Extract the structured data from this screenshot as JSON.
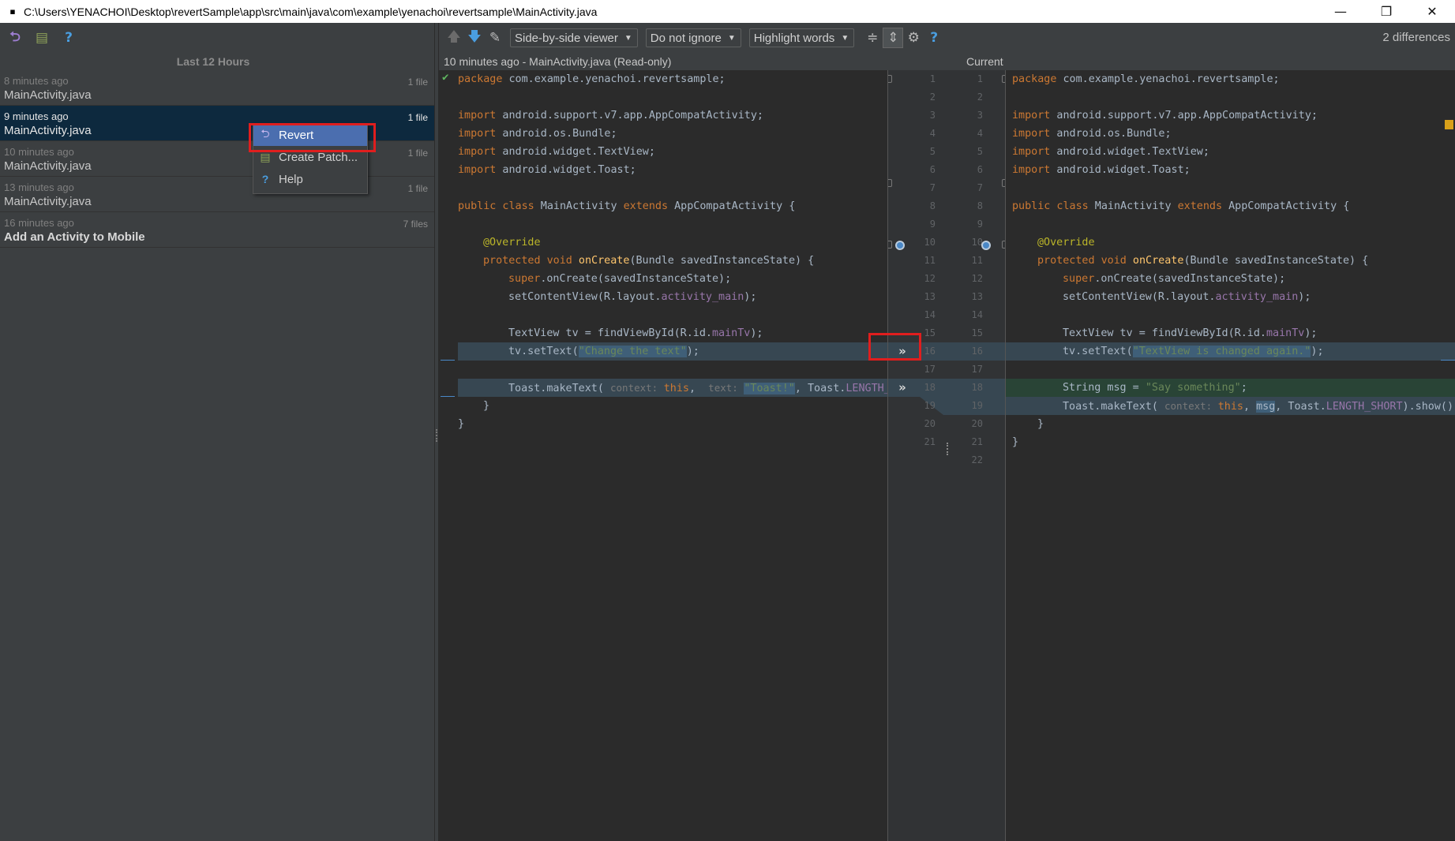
{
  "window": {
    "title": "C:\\Users\\YENACHOI\\Desktop\\revertSample\\app\\src\\main\\java\\com\\example\\yenachoi\\revertsample\\MainActivity.java",
    "minimize": "—",
    "restore": "❐",
    "close": "✕"
  },
  "history": {
    "group_label": "Last 12 Hours",
    "items": [
      {
        "time": "8 minutes ago",
        "name": "MainActivity.java",
        "count": "1 file"
      },
      {
        "time": "9 minutes ago",
        "name": "MainActivity.java",
        "count": "1 file"
      },
      {
        "time": "10 minutes ago",
        "name": "MainActivity.java",
        "count": "1 file"
      },
      {
        "time": "13 minutes ago",
        "name": "MainActivity.java",
        "count": "1 file"
      },
      {
        "time": "16 minutes ago",
        "name": "Add an Activity to Mobile",
        "count": "7 files"
      }
    ]
  },
  "context_menu": {
    "items": [
      {
        "label": "Revert",
        "icon": "revert-icon"
      },
      {
        "label": "Create Patch...",
        "icon": "patch-icon"
      },
      {
        "label": "Help",
        "icon": "help-icon"
      }
    ]
  },
  "toolbar": {
    "viewer": "Side-by-side viewer",
    "ignore": "Do not ignore",
    "highlight": "Highlight words",
    "differences": "2 differences"
  },
  "editors": {
    "left_title": "10 minutes ago - MainActivity.java (Read-only)",
    "right_title": "Current"
  },
  "left_code": {
    "l1_kw": "package",
    "l1_rest": " com.example.yenachoi.revertsample;",
    "imp": "import",
    "l3": " android.support.v7.app.AppCompatActivity;",
    "l4": " android.os.Bundle;",
    "l5": " android.widget.TextView;",
    "l6": " android.widget.Toast;",
    "l8_kw1": "public class",
    "l8_mid": " MainActivity ",
    "l8_kw2": "extends",
    "l8_end": " AppCompatActivity {",
    "l10": "@Override",
    "l11_kw": "protected void",
    "l11_fn": " onCreate",
    "l11_end": "(Bundle savedInstanceState) {",
    "l12_kw": "super",
    "l12_end": ".onCreate(savedInstanceState);",
    "l13_a": "setContentView(R.layout.",
    "l13_f": "activity_main",
    "l13_b": ");",
    "l15_a": "TextView tv = findViewById(R.id.",
    "l15_f": "mainTv",
    "l15_b": ");",
    "l16_a": "tv.setText(",
    "l16_s": "\"Change the text\"",
    "l16_b": ");",
    "l18_a": "Toast.makeText( ",
    "l18_h1": "context: ",
    "l18_kw": "this",
    "l18_c": ",  ",
    "l18_h2": "text: ",
    "l18_s": "\"Toast!\"",
    "l18_d": ", Toast.",
    "l18_f": "LENGTH_SH",
    "l19": "}",
    "l20": "}"
  },
  "right_code": {
    "l16_a": "tv.setText(",
    "l16_s": "\"TextView is changed again.\"",
    "l16_b": ");",
    "l18_a": "String msg = ",
    "l18_s": "\"Say something\"",
    "l18_b": ";",
    "l19_a": "Toast.makeText( ",
    "l19_h": "context: ",
    "l19_kw": "this",
    "l19_c": ", ",
    "l19_m": "msg",
    "l19_d": ", Toast.",
    "l19_f": "LENGTH_SHORT",
    "l19_e": ").show()",
    "l20": "}",
    "l21": "}"
  },
  "line_numbers": {
    "left": [
      "1",
      "2",
      "3",
      "4",
      "5",
      "6",
      "7",
      "8",
      "9",
      "10",
      "11",
      "12",
      "13",
      "14",
      "15",
      "16",
      "17",
      "18",
      "19",
      "20",
      "21"
    ],
    "right": [
      "1",
      "2",
      "3",
      "4",
      "5",
      "6",
      "7",
      "8",
      "9",
      "10",
      "11",
      "12",
      "13",
      "14",
      "15",
      "16",
      "17",
      "18",
      "19",
      "20",
      "21",
      "22"
    ]
  },
  "colors": {
    "accent": "#4b6eaf",
    "highlight_box": "#e01e1e",
    "modified_bg": "#374752",
    "inserted_bg": "#294436"
  }
}
